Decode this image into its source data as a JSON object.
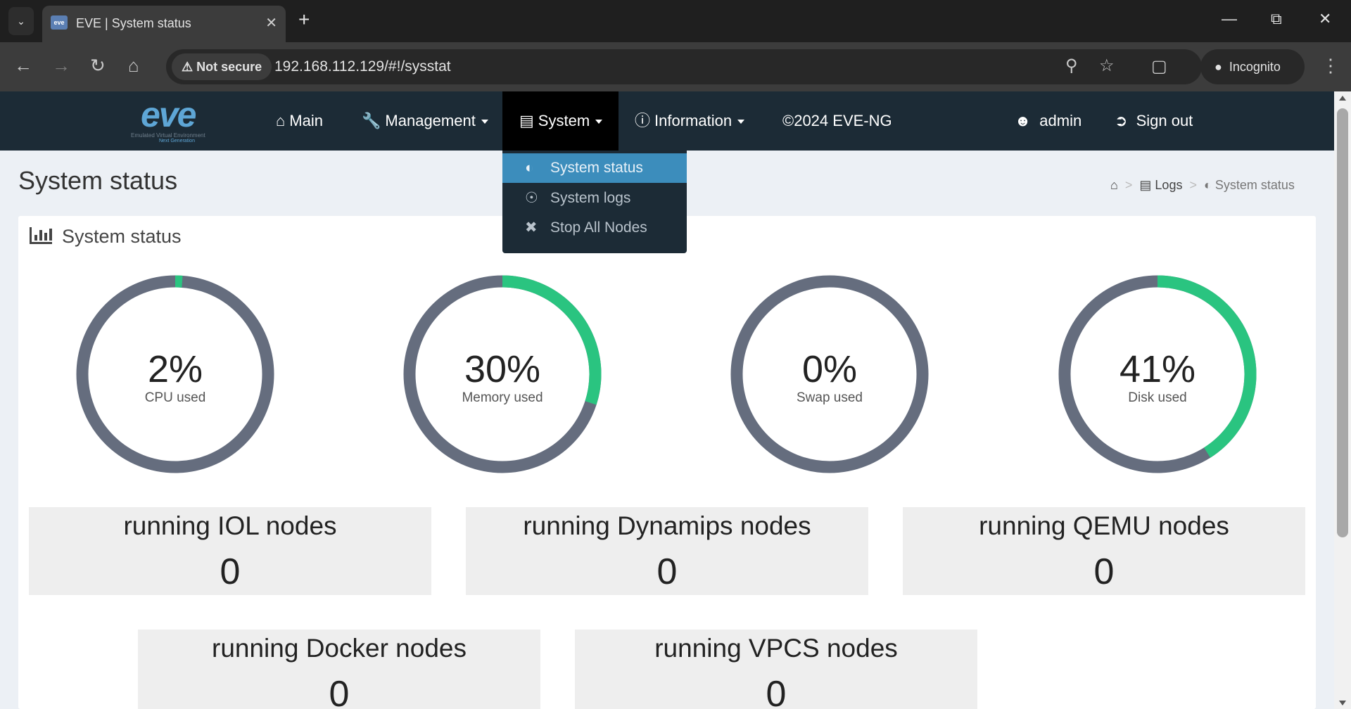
{
  "browser": {
    "tab_title": "EVE | System status",
    "favicon_text": "eve",
    "security_label": "Not secure",
    "url": "192.168.112.129/#!/sysstat",
    "incognito_label": "Incognito"
  },
  "navbar": {
    "logo_text": "eve",
    "logo_subtitle": "Emulated Virtual Environment",
    "logo_subtitle2": "Next Generation",
    "items": [
      {
        "label": "Main",
        "icon": "home-icon"
      },
      {
        "label": "Management",
        "icon": "wrench-icon"
      },
      {
        "label": "System",
        "icon": "book-icon"
      },
      {
        "label": "Information",
        "icon": "info-icon"
      },
      {
        "label": "©2024 EVE-NG"
      },
      {
        "label": "admin",
        "icon": "user-icon"
      },
      {
        "label": "Sign out",
        "icon": "sign-out-icon"
      }
    ]
  },
  "dropdown": {
    "items": [
      {
        "label": "System status",
        "icon": "adjust-icon",
        "selected": true
      },
      {
        "label": "System logs",
        "icon": "life-ring-icon"
      },
      {
        "label": "Stop All Nodes",
        "icon": "close-icon"
      }
    ]
  },
  "page": {
    "title": "System status",
    "breadcrumb": {
      "logs": "Logs",
      "current": "System status"
    },
    "box_title": "System status"
  },
  "gauges": [
    {
      "value_text": "2%",
      "label": "CPU used",
      "percent": 2
    },
    {
      "value_text": "30%",
      "label": "Memory used",
      "percent": 30
    },
    {
      "value_text": "0%",
      "label": "Swap used",
      "percent": 0
    },
    {
      "value_text": "41%",
      "label": "Disk used",
      "percent": 41
    }
  ],
  "stats": [
    {
      "title": "running IOL nodes",
      "value": "0"
    },
    {
      "title": "running Dynamips nodes",
      "value": "0"
    },
    {
      "title": "running QEMU nodes",
      "value": "0"
    },
    {
      "title": "running Docker nodes",
      "value": "0"
    },
    {
      "title": "running VPCS nodes",
      "value": "0"
    }
  ],
  "colors": {
    "gauge_track": "#656d7e",
    "gauge_fill": "#2ac480",
    "navbar_bg": "#1c2b36",
    "dropdown_selected": "#3c8dbc"
  }
}
